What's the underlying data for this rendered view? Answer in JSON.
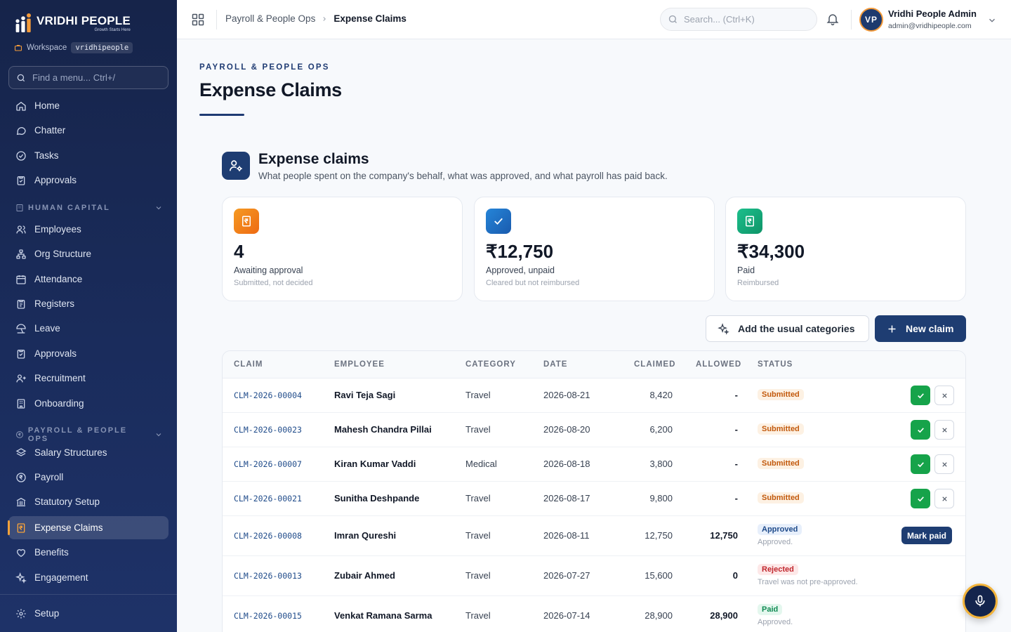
{
  "brand": {
    "name": "VRIDHI PEOPLE",
    "tagline": "Growth Starts Here"
  },
  "workspace": {
    "label": "Workspace",
    "slug": "vridhipeople"
  },
  "sidebar": {
    "search_placeholder": "Find a menu...  Ctrl+/",
    "top_items": [
      {
        "label": "Home",
        "icon": "home-icon"
      },
      {
        "label": "Chatter",
        "icon": "chat-bubble-icon"
      },
      {
        "label": "Tasks",
        "icon": "check-circle-icon"
      },
      {
        "label": "Approvals",
        "icon": "clipboard-check-icon"
      }
    ],
    "sections": [
      {
        "title": "HUMAN CAPITAL",
        "items": [
          {
            "label": "Employees",
            "icon": "users-icon"
          },
          {
            "label": "Org Structure",
            "icon": "org-chart-icon"
          },
          {
            "label": "Attendance",
            "icon": "calendar-icon"
          },
          {
            "label": "Registers",
            "icon": "clipboard-icon"
          },
          {
            "label": "Leave",
            "icon": "beach-icon"
          },
          {
            "label": "Approvals",
            "icon": "clipboard-check-icon"
          },
          {
            "label": "Recruitment",
            "icon": "user-plus-icon"
          },
          {
            "label": "Onboarding",
            "icon": "building-icon"
          }
        ]
      },
      {
        "title": "PAYROLL & PEOPLE OPS",
        "items": [
          {
            "label": "Salary Structures",
            "icon": "layers-icon"
          },
          {
            "label": "Payroll",
            "icon": "rupee-circle-icon"
          },
          {
            "label": "Statutory Setup",
            "icon": "bank-icon"
          },
          {
            "label": "Expense Claims",
            "icon": "receipt-icon",
            "active": true
          },
          {
            "label": "Benefits",
            "icon": "heart-hand-icon"
          },
          {
            "label": "Engagement",
            "icon": "sparkle-icon"
          }
        ]
      }
    ],
    "footer_item": {
      "label": "Setup",
      "icon": "gear-icon"
    }
  },
  "topbar": {
    "breadcrumb": [
      "Payroll & People Ops",
      "Expense Claims"
    ],
    "search_placeholder": "Search...  (Ctrl+K)",
    "user": {
      "initials": "VP",
      "name": "Vridhi People Admin",
      "email": "admin@vridhipeople.com"
    }
  },
  "page": {
    "eyebrow": "PAYROLL & PEOPLE OPS",
    "title": "Expense Claims",
    "section_title": "Expense claims",
    "section_subtitle": "What people spent on the company's behalf, what was approved, and what payroll has paid back."
  },
  "stats": [
    {
      "value": "4",
      "label": "Awaiting approval",
      "sub": "Submitted, not decided",
      "icon": "receipt-icon",
      "color": "#f07a1a"
    },
    {
      "value": "₹12,750",
      "label": "Approved, unpaid",
      "sub": "Cleared but not reimbursed",
      "icon": "check-icon",
      "color": "#1f6fc4"
    },
    {
      "value": "₹34,300",
      "label": "Paid",
      "sub": "Reimbursed",
      "icon": "receipt-icon",
      "color": "#12a47a"
    }
  ],
  "actions": {
    "add_categories": "Add the usual categories",
    "new_claim": "New claim"
  },
  "table": {
    "columns": [
      "CLAIM",
      "EMPLOYEE",
      "CATEGORY",
      "DATE",
      "CLAIMED",
      "ALLOWED",
      "STATUS"
    ],
    "rows": [
      {
        "claim": "CLM-2026-00004",
        "employee": "Ravi Teja Sagi",
        "category": "Travel",
        "date": "2026-08-21",
        "claimed": "8,420",
        "allowed": "-",
        "status": "Submitted",
        "note": ""
      },
      {
        "claim": "CLM-2026-00023",
        "employee": "Mahesh Chandra Pillai",
        "category": "Travel",
        "date": "2026-08-20",
        "claimed": "6,200",
        "allowed": "-",
        "status": "Submitted",
        "note": ""
      },
      {
        "claim": "CLM-2026-00007",
        "employee": "Kiran Kumar Vaddi",
        "category": "Medical",
        "date": "2026-08-18",
        "claimed": "3,800",
        "allowed": "-",
        "status": "Submitted",
        "note": ""
      },
      {
        "claim": "CLM-2026-00021",
        "employee": "Sunitha Deshpande",
        "category": "Travel",
        "date": "2026-08-17",
        "claimed": "9,800",
        "allowed": "-",
        "status": "Submitted",
        "note": ""
      },
      {
        "claim": "CLM-2026-00008",
        "employee": "Imran Qureshi",
        "category": "Travel",
        "date": "2026-08-11",
        "claimed": "12,750",
        "allowed": "12,750",
        "status": "Approved",
        "note": "Approved.",
        "action": "Mark paid"
      },
      {
        "claim": "CLM-2026-00013",
        "employee": "Zubair Ahmed",
        "category": "Travel",
        "date": "2026-07-27",
        "claimed": "15,600",
        "allowed": "0",
        "status": "Rejected",
        "note": "Travel was not pre-approved."
      },
      {
        "claim": "CLM-2026-00015",
        "employee": "Venkat Ramana Sarma",
        "category": "Travel",
        "date": "2026-07-14",
        "claimed": "28,900",
        "allowed": "28,900",
        "status": "Paid",
        "note": "Approved."
      }
    ]
  },
  "colors": {
    "navy": "#1e3d72",
    "accent": "#f29a3a",
    "success": "#16a34a"
  }
}
